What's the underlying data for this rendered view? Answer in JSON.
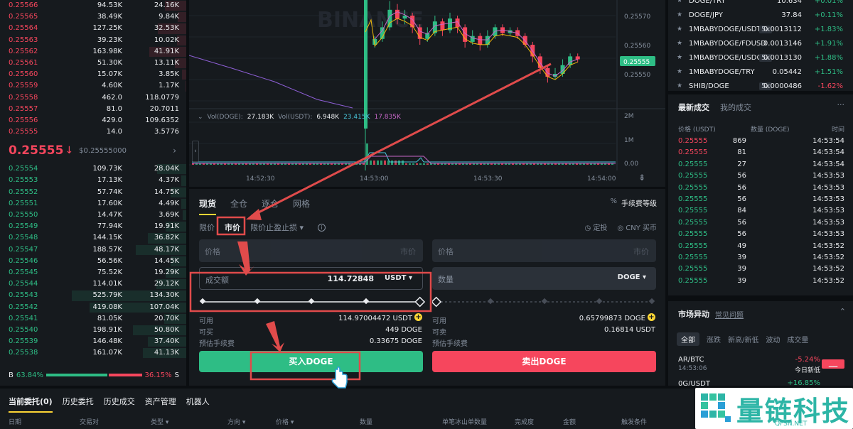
{
  "orderbook": {
    "asks": [
      {
        "price": "0.25566",
        "amount": "94.53K",
        "total": "24.16K",
        "depth": 0.2
      },
      {
        "price": "0.25565",
        "amount": "38.49K",
        "total": "9.84K",
        "depth": 0.08
      },
      {
        "price": "0.25564",
        "amount": "127.25K",
        "total": "32.53K",
        "depth": 0.27
      },
      {
        "price": "0.25563",
        "amount": "39.23K",
        "total": "10.02K",
        "depth": 0.09
      },
      {
        "price": "0.25562",
        "amount": "163.98K",
        "total": "41.91K",
        "depth": 0.35
      },
      {
        "price": "0.25561",
        "amount": "51.30K",
        "total": "13.11K",
        "depth": 0.11
      },
      {
        "price": "0.25560",
        "amount": "15.07K",
        "total": "3.85K",
        "depth": 0.04
      },
      {
        "price": "0.25559",
        "amount": "4.60K",
        "total": "1.17K",
        "depth": 0.01
      },
      {
        "price": "0.25558",
        "amount": "462.0",
        "total": "118.0779",
        "depth": 0.0
      },
      {
        "price": "0.25557",
        "amount": "81.0",
        "total": "20.7011",
        "depth": 0.0
      },
      {
        "price": "0.25556",
        "amount": "429.0",
        "total": "109.6352",
        "depth": 0.0
      },
      {
        "price": "0.25555",
        "amount": "14.0",
        "total": "3.5776",
        "depth": 0.0
      }
    ],
    "mid_price": "0.25555",
    "mid_arrow": "↓",
    "mid_usd": "$0.25555000",
    "bids": [
      {
        "price": "0.25554",
        "amount": "109.73K",
        "total": "28.04K",
        "depth": 0.24
      },
      {
        "price": "0.25553",
        "amount": "17.13K",
        "total": "4.37K",
        "depth": 0.04
      },
      {
        "price": "0.25552",
        "amount": "57.74K",
        "total": "14.75K",
        "depth": 0.13
      },
      {
        "price": "0.25551",
        "amount": "17.60K",
        "total": "4.49K",
        "depth": 0.04
      },
      {
        "price": "0.25550",
        "amount": "14.47K",
        "total": "3.69K",
        "depth": 0.03
      },
      {
        "price": "0.25549",
        "amount": "77.94K",
        "total": "19.91K",
        "depth": 0.17
      },
      {
        "price": "0.25548",
        "amount": "144.15K",
        "total": "36.82K",
        "depth": 0.32
      },
      {
        "price": "0.25547",
        "amount": "188.57K",
        "total": "48.17K",
        "depth": 0.42
      },
      {
        "price": "0.25546",
        "amount": "56.56K",
        "total": "14.45K",
        "depth": 0.13
      },
      {
        "price": "0.25545",
        "amount": "75.52K",
        "total": "19.29K",
        "depth": 0.17
      },
      {
        "price": "0.25544",
        "amount": "114.01K",
        "total": "29.12K",
        "depth": 0.25
      },
      {
        "price": "0.25543",
        "amount": "525.79K",
        "total": "134.30K",
        "depth": 0.95
      },
      {
        "price": "0.25542",
        "amount": "419.08K",
        "total": "107.04K",
        "depth": 0.8
      },
      {
        "price": "0.25541",
        "amount": "81.05K",
        "total": "20.70K",
        "depth": 0.18
      },
      {
        "price": "0.25540",
        "amount": "198.91K",
        "total": "50.80K",
        "depth": 0.44
      },
      {
        "price": "0.25539",
        "amount": "146.48K",
        "total": "37.40K",
        "depth": 0.32
      },
      {
        "price": "0.25538",
        "amount": "161.07K",
        "total": "41.13K",
        "depth": 0.36
      }
    ],
    "buy_label": "B",
    "buy_pct": "63.84%",
    "sell_pct": "36.15%",
    "sell_label": "S",
    "buy_ratio": 0.6384
  },
  "chart": {
    "watermark": "BINANCE",
    "price_ticks": [
      "0.25570",
      "0.25560",
      "0.25550"
    ],
    "current_price": "0.25555",
    "vol_ticks": [
      "2M",
      "1M",
      "0.00"
    ],
    "vol_label": "Vol(DOGE):",
    "vol_doge": "27.183K",
    "vol_usdt_label": "Vol(USDT):",
    "vol_usdt": "6.948K",
    "vol_ma1": "23.415K",
    "vol_ma2": "17.835K",
    "time_ticks": [
      "14:52:30",
      "14:53:00",
      "14:53:30",
      "14:54:00"
    ],
    "candles": [
      {
        "o": 0.2556,
        "c": 0.25562,
        "h": 0.25563,
        "l": 0.25559
      },
      {
        "o": 0.25562,
        "c": 0.25566,
        "h": 0.25568,
        "l": 0.25561
      },
      {
        "o": 0.25566,
        "c": 0.25572,
        "h": 0.25575,
        "l": 0.25565
      },
      {
        "o": 0.25572,
        "c": 0.25569,
        "h": 0.25574,
        "l": 0.25567
      },
      {
        "o": 0.25569,
        "c": 0.2557,
        "h": 0.25572,
        "l": 0.25567
      },
      {
        "o": 0.2557,
        "c": 0.25566,
        "h": 0.25571,
        "l": 0.25564
      },
      {
        "o": 0.25566,
        "c": 0.25562,
        "h": 0.25567,
        "l": 0.2556
      },
      {
        "o": 0.25562,
        "c": 0.25564,
        "h": 0.25566,
        "l": 0.25561
      },
      {
        "o": 0.25564,
        "c": 0.25568,
        "h": 0.2557,
        "l": 0.25563
      },
      {
        "o": 0.25568,
        "c": 0.25565,
        "h": 0.25569,
        "l": 0.25563
      },
      {
        "o": 0.25565,
        "c": 0.25569,
        "h": 0.25571,
        "l": 0.25564
      },
      {
        "o": 0.25569,
        "c": 0.25566,
        "h": 0.2557,
        "l": 0.25564
      },
      {
        "o": 0.25566,
        "c": 0.25561,
        "h": 0.25567,
        "l": 0.25559
      },
      {
        "o": 0.25561,
        "c": 0.25563,
        "h": 0.25565,
        "l": 0.2556
      },
      {
        "o": 0.25563,
        "c": 0.2556,
        "h": 0.25564,
        "l": 0.25558
      },
      {
        "o": 0.2556,
        "c": 0.25563,
        "h": 0.25565,
        "l": 0.25559
      },
      {
        "o": 0.25563,
        "c": 0.25566,
        "h": 0.25567,
        "l": 0.25562
      },
      {
        "o": 0.25566,
        "c": 0.25564,
        "h": 0.25567,
        "l": 0.25563
      },
      {
        "o": 0.25564,
        "c": 0.25565,
        "h": 0.25566,
        "l": 0.25563
      },
      {
        "o": 0.25565,
        "c": 0.25563,
        "h": 0.25566,
        "l": 0.25562
      },
      {
        "o": 0.25563,
        "c": 0.2556,
        "h": 0.25564,
        "l": 0.25559
      },
      {
        "o": 0.2556,
        "c": 0.25556,
        "h": 0.25561,
        "l": 0.25554
      },
      {
        "o": 0.25556,
        "c": 0.25552,
        "h": 0.25557,
        "l": 0.2555
      },
      {
        "o": 0.25552,
        "c": 0.25549,
        "h": 0.25553,
        "l": 0.25547
      },
      {
        "o": 0.25549,
        "c": 0.2555,
        "h": 0.25552,
        "l": 0.25548
      },
      {
        "o": 0.2555,
        "c": 0.25553,
        "h": 0.25555,
        "l": 0.25549
      },
      {
        "o": 0.25553,
        "c": 0.25556,
        "h": 0.25557,
        "l": 0.25552
      },
      {
        "o": 0.25556,
        "c": 0.25555,
        "h": 0.25557,
        "l": 0.25554
      }
    ],
    "spike": {
      "o": 0.2554,
      "c": 0.2558,
      "h": 0.25582,
      "l": 0.2552
    }
  },
  "form": {
    "tabs": [
      "现货",
      "全仓",
      "逐仓",
      "网格"
    ],
    "fee_label": "手续费等级",
    "order_types": {
      "limit": "限价",
      "market": "市价",
      "stop": "限价止盈止损 ▾"
    },
    "lock_label": "定投",
    "cny_label": "CNY 买币",
    "buy_price_label": "价格",
    "buy_price_value": "市价",
    "sell_price_label": "价格",
    "sell_price_value": "市价",
    "turnover_label": "成交额",
    "turnover_value": "114.72848",
    "turnover_unit": "USDT ▾",
    "qty_label": "数量",
    "qty_unit": "DOGE ▾",
    "buy_avail_label": "可用",
    "buy_avail": "114.97004472 USDT",
    "buy_can_label": "可买",
    "buy_can": "449 DOGE",
    "buy_fee_label": "预估手续费",
    "buy_fee": "0.33675 DOGE",
    "sell_avail_label": "可用",
    "sell_avail": "0.65799873 DOGE",
    "sell_can_label": "可卖",
    "sell_can": "0.16814 USDT",
    "sell_fee_label": "预估手续费",
    "buy_button": "买入DOGE",
    "sell_button": "卖出DOGE",
    "slider_position": 1.0
  },
  "ticker": [
    {
      "pair": "DOGE/TRY",
      "lev": "",
      "price": "10.634",
      "change": "+0.01%",
      "up": true
    },
    {
      "pair": "DOGE/JPY",
      "lev": "",
      "price": "37.84",
      "change": "+0.11%",
      "up": true
    },
    {
      "pair": "1MBABYDOGE/USDT",
      "lev": "5x",
      "price": "0.0013112",
      "change": "+1.83%",
      "up": true
    },
    {
      "pair": "1MBABYDOGE/FDUSD",
      "lev": "",
      "price": "0.0013146",
      "change": "+1.91%",
      "up": true
    },
    {
      "pair": "1MBABYDOGE/USDC",
      "lev": "5x",
      "price": "0.0013130",
      "change": "+1.88%",
      "up": true
    },
    {
      "pair": "1MBABYDOGE/TRY",
      "lev": "",
      "price": "0.05442",
      "change": "+1.51%",
      "up": true
    },
    {
      "pair": "SHIB/DOGE",
      "lev": "5x",
      "price": "0.0000486",
      "change": "-1.62%",
      "up": false
    }
  ],
  "trades": {
    "tab_latest": "最新成交",
    "tab_mine": "我的成交",
    "more": "···",
    "col_price": "价格 (USDT)",
    "col_qty": "数量 (DOGE)",
    "col_time": "时间",
    "rows": [
      {
        "price": "0.25555",
        "qty": "869",
        "time": "14:53:54",
        "up": false
      },
      {
        "price": "0.25555",
        "qty": "81",
        "time": "14:53:54",
        "up": false
      },
      {
        "price": "0.25555",
        "qty": "27",
        "time": "14:53:54",
        "up": true
      },
      {
        "price": "0.25555",
        "qty": "56",
        "time": "14:53:53",
        "up": true
      },
      {
        "price": "0.25555",
        "qty": "56",
        "time": "14:53:53",
        "up": true
      },
      {
        "price": "0.25555",
        "qty": "56",
        "time": "14:53:53",
        "up": true
      },
      {
        "price": "0.25555",
        "qty": "84",
        "time": "14:53:53",
        "up": true
      },
      {
        "price": "0.25555",
        "qty": "56",
        "time": "14:53:53",
        "up": true
      },
      {
        "price": "0.25555",
        "qty": "56",
        "time": "14:53:53",
        "up": true
      },
      {
        "price": "0.25555",
        "qty": "49",
        "time": "14:53:52",
        "up": true
      },
      {
        "price": "0.25555",
        "qty": "39",
        "time": "14:53:52",
        "up": true
      },
      {
        "price": "0.25555",
        "qty": "39",
        "time": "14:53:52",
        "up": true
      },
      {
        "price": "0.25555",
        "qty": "39",
        "time": "14:53:52",
        "up": true
      }
    ]
  },
  "moves": {
    "title": "市场异动",
    "faq": "常见问题",
    "tabs": [
      "全部",
      "涨跌",
      "新高/新低",
      "波动",
      "成交量"
    ],
    "items": [
      {
        "pair": "AR/BTC",
        "time": "14:53:06",
        "change": "-5.24%",
        "desc": "今日新低",
        "up": false
      },
      {
        "pair": "0G/USDT",
        "time": "",
        "change": "+16.85%",
        "desc": "",
        "up": true
      }
    ]
  },
  "bottom": {
    "tabs": [
      "当前委托(0)",
      "历史委托",
      "历史成交",
      "资产管理",
      "机器人"
    ],
    "cols": [
      "日期",
      "交易对",
      "类型 ▾",
      "方向 ▾",
      "价格 ▾",
      "数量",
      "单笔冰山单数量",
      "完成度",
      "金额",
      "触发条件"
    ]
  },
  "logo": {
    "name": "量链科技",
    "url": "QFSN.NET"
  },
  "colors": {
    "green": "#2ebd85",
    "red": "#f6465d",
    "annotation": "#e04b4b",
    "accent": "#fcd535"
  }
}
